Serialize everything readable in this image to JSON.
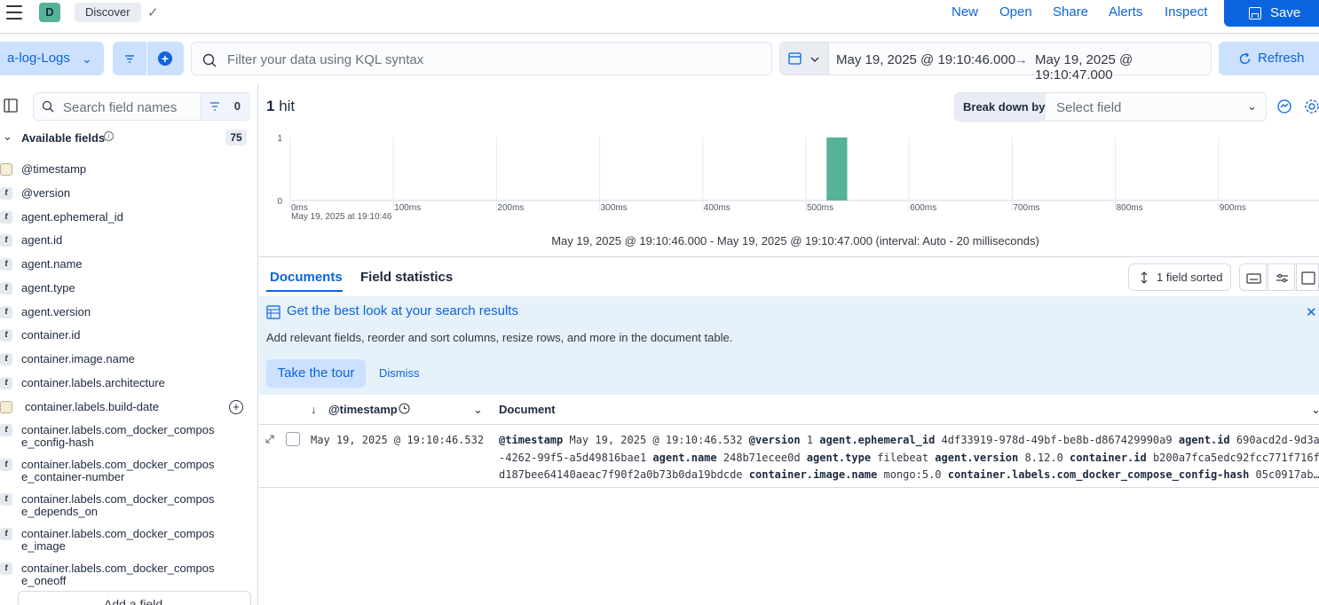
{
  "header": {
    "space_initial": "D",
    "breadcrumb": "Discover",
    "links": [
      "New",
      "Open",
      "Share",
      "Alerts",
      "Inspect"
    ],
    "save_label": "Save"
  },
  "querybar": {
    "dataview": "a-log-Logs",
    "kql_placeholder": "Filter your data using KQL syntax",
    "start": "May 19, 2025 @ 19:10:46.000",
    "end": "May 19, 2025 @ 19:10:47.000",
    "refresh_label": "Refresh"
  },
  "sidebar": {
    "search_placeholder": "Search field names",
    "filter_count": "0",
    "available_title": "Available fields",
    "available_count": "75",
    "fields": [
      {
        "type": "date",
        "name": "@timestamp"
      },
      {
        "type": "t",
        "name": "@version"
      },
      {
        "type": "t",
        "name": "agent.ephemeral_id"
      },
      {
        "type": "t",
        "name": "agent.id"
      },
      {
        "type": "t",
        "name": "agent.name"
      },
      {
        "type": "t",
        "name": "agent.type"
      },
      {
        "type": "t",
        "name": "agent.version"
      },
      {
        "type": "t",
        "name": "container.id"
      },
      {
        "type": "t",
        "name": "container.image.name"
      },
      {
        "type": "t",
        "name": "container.labels.architecture"
      },
      {
        "type": "date",
        "name": "container.labels.build-date"
      },
      {
        "type": "t",
        "name": "container.labels.com_docker_compos",
        "name2": "e_config-hash"
      },
      {
        "type": "t",
        "name": "container.labels.com_docker_compos",
        "name2": "e_container-number"
      },
      {
        "type": "t",
        "name": "container.labels.com_docker_compos",
        "name2": "e_depends_on"
      },
      {
        "type": "t",
        "name": "container.labels.com_docker_compos",
        "name2": "e_image"
      },
      {
        "type": "t",
        "name": "container.labels.com_docker_compos",
        "name2": "e_oneoff"
      }
    ],
    "add_field_label": "Add a field"
  },
  "main": {
    "hit_count": "1",
    "hit_label": "hit",
    "breakdown_label": "Break down by",
    "breakdown_placeholder": "Select field",
    "histogram_caption": "May 19, 2025 @ 19:10:46.000 - May 19, 2025 @ 19:10:47.000 (interval: Auto - 20 milliseconds)",
    "tabs": [
      "Documents",
      "Field statistics"
    ],
    "sorted_label": "1 field sorted",
    "callout_title": "Get the best look at your search results",
    "callout_text": "Add relevant fields, reorder and sort columns, resize rows, and more in the document table.",
    "tour_label": "Take the tour",
    "dismiss_label": "Dismiss",
    "col_timestamp": "@timestamp",
    "col_document": "Document",
    "row": {
      "timestamp": "May 19, 2025 @ 19:10:46.532",
      "doc_line1": [
        {
          "k": "@timestamp",
          "v": "May 19, 2025 @ 19:10:46.532"
        },
        {
          "k": "@version",
          "v": "1"
        },
        {
          "k": "agent.ephemeral_id",
          "v": "4df33919-978d-49bf-be8b-d867429990a9"
        },
        {
          "k": "agent.id",
          "v": "690acd2d-9d3a"
        }
      ],
      "doc_line2_prefix": "-4262-99f5-a5d49816bae1",
      "doc_line2": [
        {
          "k": "agent.name",
          "v": "248b71ecee0d"
        },
        {
          "k": "agent.type",
          "v": "filebeat"
        },
        {
          "k": "agent.version",
          "v": "8.12.0"
        },
        {
          "k": "container.id",
          "v": "b200a7fca5edc92fcc771f716f"
        }
      ],
      "doc_line3_prefix": "d187bee64140aeac7f90f2a0b73b0da19bdcde",
      "doc_line3": [
        {
          "k": "container.image.name",
          "v": "mongo:5.0"
        },
        {
          "k": "container.labels.com_docker_compose_config-hash",
          "v": "05c0917ab…"
        }
      ]
    }
  },
  "chart_data": {
    "type": "bar",
    "x_tick_labels": [
      "0ms",
      "100ms",
      "200ms",
      "300ms",
      "400ms",
      "500ms",
      "600ms",
      "700ms",
      "800ms",
      "900ms"
    ],
    "x_sublabel": "May 19, 2025 at 19:10:46",
    "y_ticks": [
      "1",
      "0"
    ],
    "ylim": [
      0,
      1
    ],
    "xlim_ms": [
      0,
      1000
    ],
    "bins": [
      {
        "x_ms": 520,
        "count": 1
      }
    ],
    "bar_color": "#54b399",
    "legend": "none",
    "grid": "vertical"
  },
  "colors": {
    "accent": "#0b64dd",
    "bar": "#54b399",
    "callout_bg": "#e6f1fa"
  }
}
